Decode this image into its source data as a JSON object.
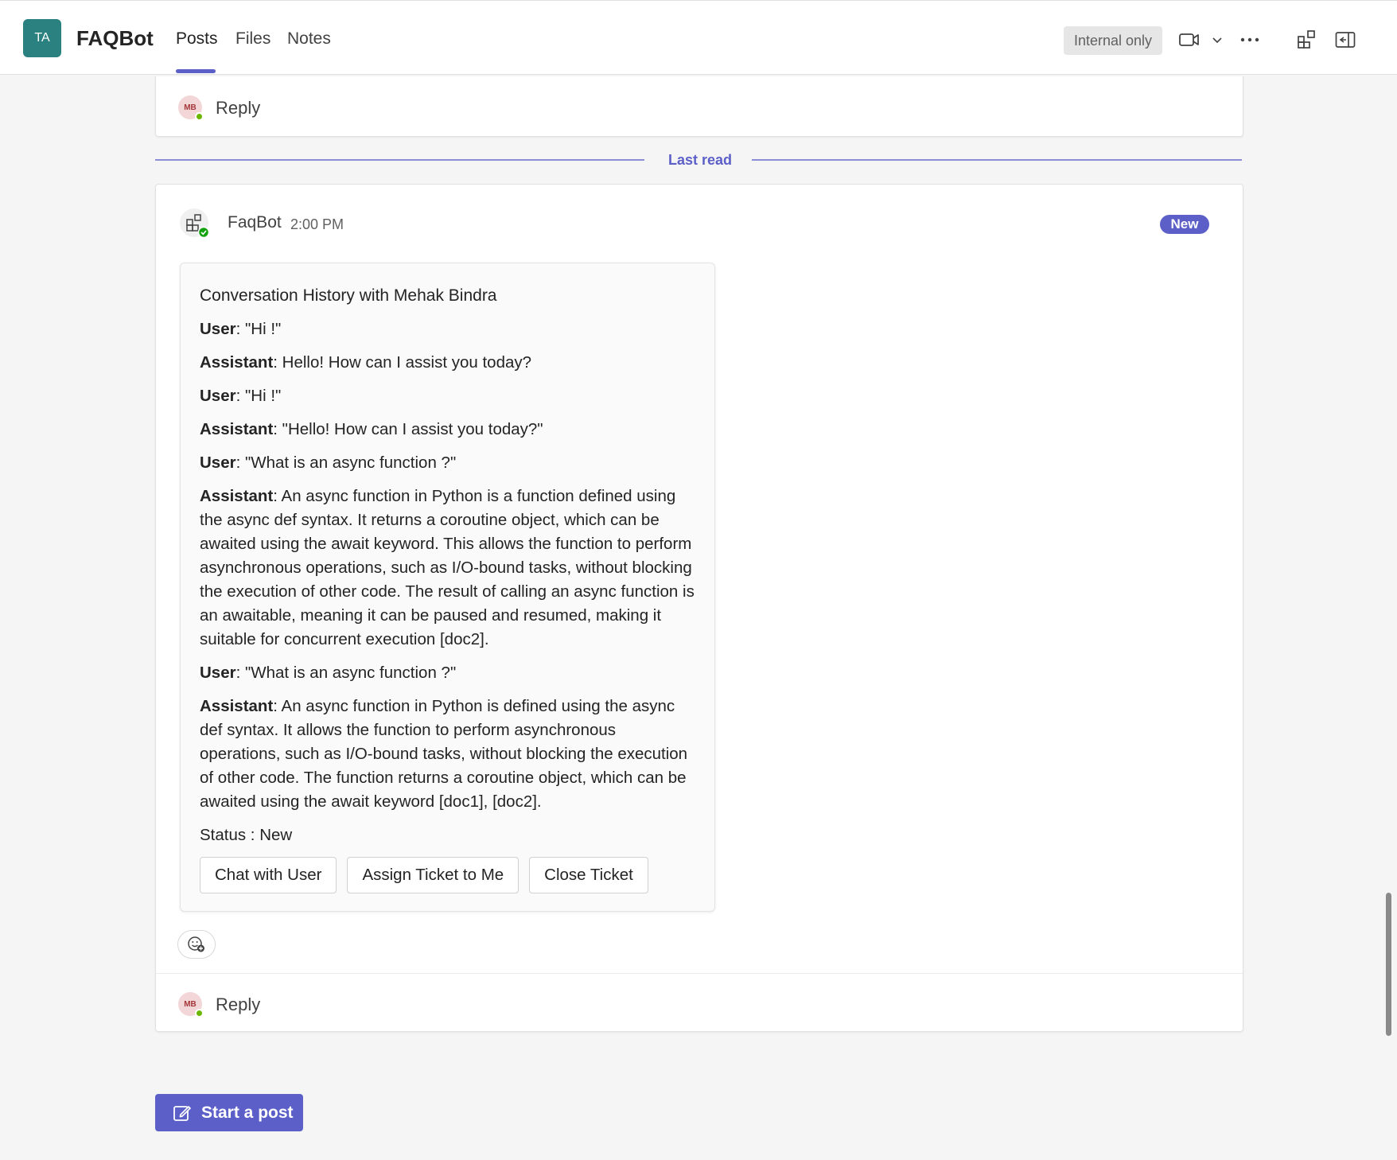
{
  "header": {
    "team_initials": "TA",
    "team_name": "FAQBot",
    "tabs": [
      {
        "label": "Posts"
      },
      {
        "label": "Files"
      },
      {
        "label": "Notes"
      }
    ],
    "sensitivity_label": "Internal only",
    "icons": [
      "video-camera-icon",
      "chevron-down-icon",
      "more-options-icon",
      "apps-icon",
      "side-panel-icon"
    ]
  },
  "top_reply": {
    "avatar_initials": "MB",
    "label": "Reply"
  },
  "last_read": "Last read",
  "post": {
    "author": "FaqBot",
    "time": "2:00 PM",
    "badge": "New",
    "card": {
      "title": "Conversation History with Mehak Bindra",
      "messages": [
        {
          "speaker": "User",
          "text": ": \"Hi !\""
        },
        {
          "speaker": "Assistant",
          "text": ": Hello! How can I assist you today?"
        },
        {
          "speaker": "User",
          "text": ": \"Hi !\""
        },
        {
          "speaker": "Assistant",
          "text": ": \"Hello! How can I assist you today?\""
        },
        {
          "speaker": "User",
          "text": ": \"What is an async function ?\""
        },
        {
          "speaker": "Assistant",
          "text": ": An async function in Python is a function defined using the async def syntax. It returns a coroutine object, which can be awaited using the await keyword. This allows the function to perform asynchronous operations, such as I/O-bound tasks, without blocking the execution of other code. The result of calling an async function is an awaitable, meaning it can be paused and resumed, making it suitable for concurrent execution [doc2]."
        },
        {
          "speaker": "User",
          "text": ": \"What is an async function ?\""
        },
        {
          "speaker": "Assistant",
          "text": ": An async function in Python is defined using the async def syntax. It allows the function to perform asynchronous operations, such as I/O-bound tasks, without blocking the execution of other code. The function returns a coroutine object, which can be awaited using the await keyword [doc1], [doc2]."
        }
      ],
      "status": "Status : New",
      "buttons": [
        "Chat with User",
        "Assign Ticket to Me",
        "Close Ticket"
      ]
    },
    "reply": {
      "avatar_initials": "MB",
      "label": "Reply"
    }
  },
  "start_post_label": "Start a post",
  "colors": {
    "accent": "#5b5fc7",
    "team_avatar": "#2a8180",
    "presence": "#6bb700"
  }
}
